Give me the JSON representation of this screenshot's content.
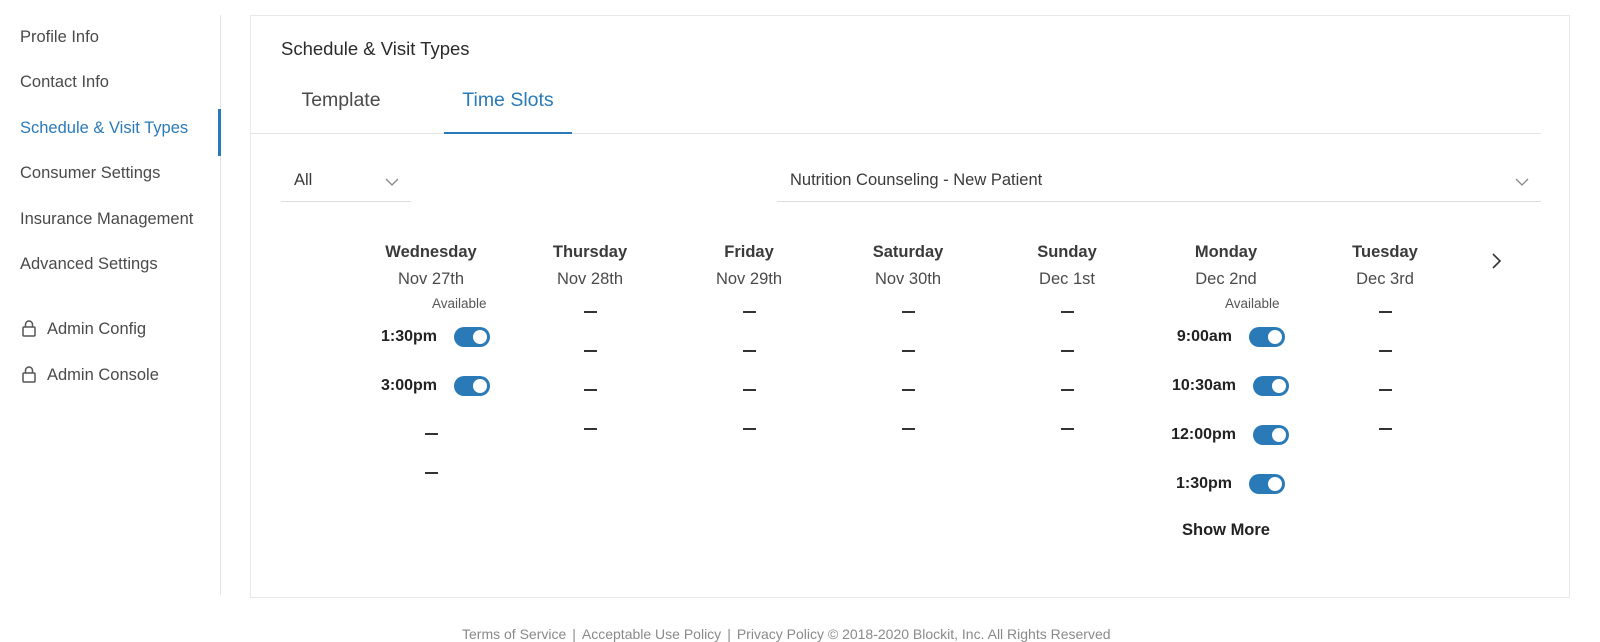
{
  "sidebar": {
    "items": [
      {
        "label": "Profile Info"
      },
      {
        "label": "Contact Info"
      },
      {
        "label": "Schedule & Visit Types"
      },
      {
        "label": "Consumer Settings"
      },
      {
        "label": "Insurance Management"
      },
      {
        "label": "Advanced Settings"
      },
      {
        "label": "Admin Config",
        "icon": "lock-icon"
      },
      {
        "label": "Admin Console",
        "icon": "lock-icon"
      }
    ],
    "active_index": 2
  },
  "panel": {
    "title": "Schedule & Visit Types",
    "tabs": [
      {
        "label": "Template"
      },
      {
        "label": "Time Slots",
        "active": true
      }
    ],
    "filters": {
      "provider_filter": "All",
      "visit_type": "Nutrition Counseling - New Patient"
    }
  },
  "days": [
    {
      "name": "Wednesday",
      "date": "Nov 27th",
      "available_label": "Available",
      "slots": [
        {
          "time": "1:30pm",
          "enabled": true
        },
        {
          "time": "3:00pm",
          "enabled": true
        }
      ],
      "dashes": 2
    },
    {
      "name": "Thursday",
      "date": "Nov 28th",
      "dashes": 4
    },
    {
      "name": "Friday",
      "date": "Nov 29th",
      "dashes": 4
    },
    {
      "name": "Saturday",
      "date": "Nov 30th",
      "dashes": 4
    },
    {
      "name": "Sunday",
      "date": "Dec 1st",
      "dashes": 4
    },
    {
      "name": "Monday",
      "date": "Dec 2nd",
      "available_label": "Available",
      "slots": [
        {
          "time": "9:00am",
          "enabled": true
        },
        {
          "time": "10:30am",
          "enabled": true
        },
        {
          "time": "12:00pm",
          "enabled": true
        },
        {
          "time": "1:30pm",
          "enabled": true
        }
      ],
      "show_more": "Show More"
    },
    {
      "name": "Tuesday",
      "date": "Dec 3rd",
      "dashes": 4
    }
  ],
  "footer": {
    "links": [
      "Terms of Service",
      "Acceptable Use Policy",
      "Privacy Policy"
    ],
    "copyright": "© 2018-2020 Blockit, Inc. All Rights Reserved"
  },
  "colors": {
    "accent": "#2a7ab8",
    "text": "#333333",
    "border": "#e4e4e4"
  }
}
